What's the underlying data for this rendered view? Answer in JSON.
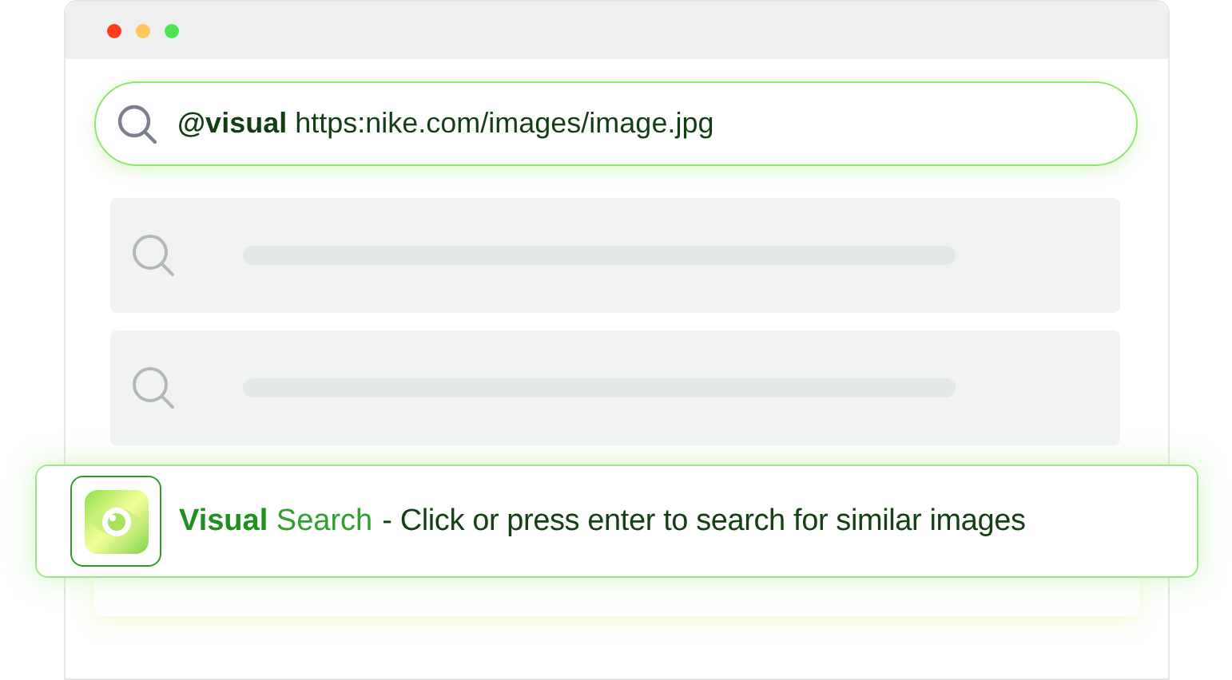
{
  "window": {
    "controls": [
      {
        "color": "#ff3b1f"
      },
      {
        "color": "#ffc75a"
      },
      {
        "color": "#4be64b"
      }
    ]
  },
  "search": {
    "value": "**@visual** https:nike.com/images/image.jpg"
  },
  "results": [
    {
      "kind": "skeleton"
    },
    {
      "kind": "skeleton"
    }
  ],
  "suggestion": {
    "title": "**Visual** Search",
    "description": "- Click or press enter to search for similar images"
  }
}
